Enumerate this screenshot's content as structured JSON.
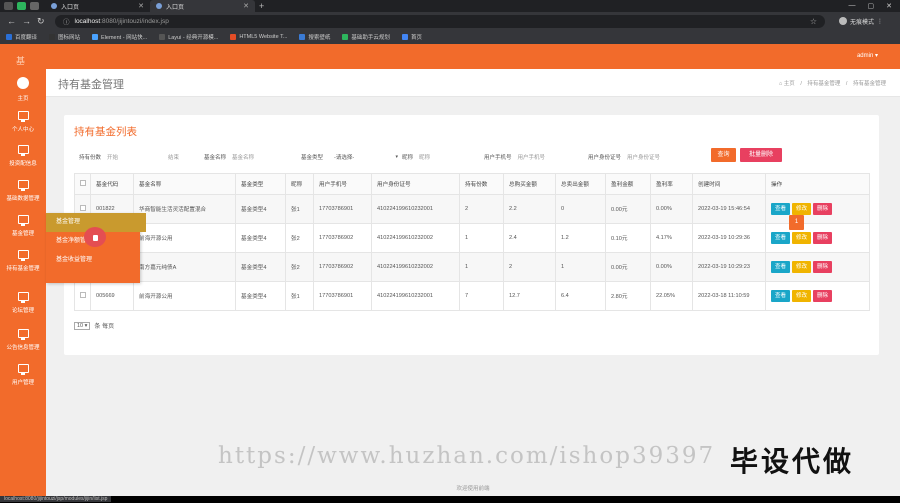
{
  "browser": {
    "tabs": [
      {
        "title": "入口页"
      },
      {
        "title": "入口页"
      }
    ],
    "url_host": "localhost",
    "url_rest": ":8080/jijintouzi/index.jsp",
    "profile": "无痕模式",
    "bookmarks": [
      "百度翻译",
      "图标网站",
      "Element - 网站快...",
      "Layui - 经典开源模...",
      "HTML5 Website T...",
      "搜索壁纸",
      "基础助手云规划",
      "首页"
    ],
    "bookmark_colors": [
      "#2a6fd6",
      "#333333",
      "#4aa3ff",
      "#555555",
      "#e44d26",
      "#3a7bd5",
      "#2db55d",
      "#4285f4"
    ],
    "status_url": "localhost:8080/jijintouzi/jsp/modules/jijin/list.jsp"
  },
  "app": {
    "logo": "基",
    "admin": "admin",
    "sidebar": [
      {
        "label": "主页",
        "icon": "home-icon"
      },
      {
        "label": "个人中心",
        "icon": "monitor-icon"
      },
      {
        "label": "投资配信息",
        "icon": "monitor-icon"
      },
      {
        "label": "基础数据管理",
        "icon": "monitor-icon"
      },
      {
        "label": "基金管理",
        "icon": "monitor-icon"
      },
      {
        "label": "持有基金管理",
        "icon": "monitor-icon"
      },
      {
        "label": "论坛管理",
        "icon": "monitor-icon"
      },
      {
        "label": "公告信息管理",
        "icon": "monitor-icon"
      },
      {
        "label": "用户管理",
        "icon": "monitor-icon"
      }
    ],
    "submenu": [
      "基金管理",
      "基金净额管理",
      "基金收益管理"
    ]
  },
  "page": {
    "title": "持有基金管理",
    "breadcrumb": [
      "主页",
      "持有基金管理",
      "持有基金管理"
    ],
    "card_title": "持有基金列表",
    "filters": {
      "hold_label": "持有份数",
      "hold_from_ph": "开始",
      "hold_to_ph": "结束",
      "name_label": "基金名称",
      "name_ph": "基金名称",
      "type_label": "基金类型",
      "type_value": "-请选择-",
      "nick_label": "昵称",
      "nick_ph": "昵称",
      "phone_label": "用户手机号",
      "phone_ph": "用户手机号",
      "id_label": "用户身份证号",
      "id_ph": "用户身份证号"
    },
    "buttons": {
      "search": "查询",
      "batch_delete": "批量删除"
    },
    "colors": {
      "primary": "#f26b2b",
      "view": "#1aa6c8",
      "edit": "#f0b400",
      "delete": "#e84060"
    },
    "columns": [
      "基金代码",
      "基金名称",
      "基金类型",
      "昵称",
      "用户手机号",
      "用户身份证号",
      "持有份数",
      "总购买金额",
      "总卖出金额",
      "盈利金额",
      "盈利率",
      "创建时间",
      "操作"
    ],
    "rows": [
      {
        "code": "001822",
        "name": "华商智能生活灵活配置混合",
        "type": "基金类型4",
        "nick": "张1",
        "phone": "17703786901",
        "idno": "410224199610232001",
        "hold": "2",
        "buy": "2.2",
        "sell": "0",
        "profit": "0.00元",
        "rate": "0.00%",
        "created": "2022-03-19 15:46:54"
      },
      {
        "code": "",
        "name": "前海开源公用",
        "type": "基金类型4",
        "nick": "张2",
        "phone": "17703786902",
        "idno": "410224199610232002",
        "hold": "1",
        "buy": "2.4",
        "sell": "1.2",
        "profit": "0.10元",
        "rate": "4.17%",
        "created": "2022-03-19 10:29:36"
      },
      {
        "code": "",
        "name": "南方嘉元纯债A",
        "type": "基金类型4",
        "nick": "张2",
        "phone": "17703786902",
        "idno": "410224199610232002",
        "hold": "1",
        "buy": "2",
        "sell": "1",
        "profit": "0.00元",
        "rate": "0.00%",
        "created": "2022-03-19 10:29:23"
      },
      {
        "code": "005669",
        "name": "前海开源公用",
        "type": "基金类型4",
        "nick": "张1",
        "phone": "17703786901",
        "idno": "410224199610232001",
        "hold": "7",
        "buy": "12.7",
        "sell": "6.4",
        "profit": "2.80元",
        "rate": "22.05%",
        "created": "2022-03-18 11:10:59"
      }
    ],
    "row_actions": [
      "查看",
      "修改",
      "删除"
    ],
    "page_size": "10",
    "page_size_suffix": "条 每页",
    "current_page": "1",
    "footer": "欢迎使用前端"
  },
  "overlay": {
    "watermark_url": "https://www.huzhan.com/ishop39397",
    "watermark_text": "毕设代做"
  }
}
